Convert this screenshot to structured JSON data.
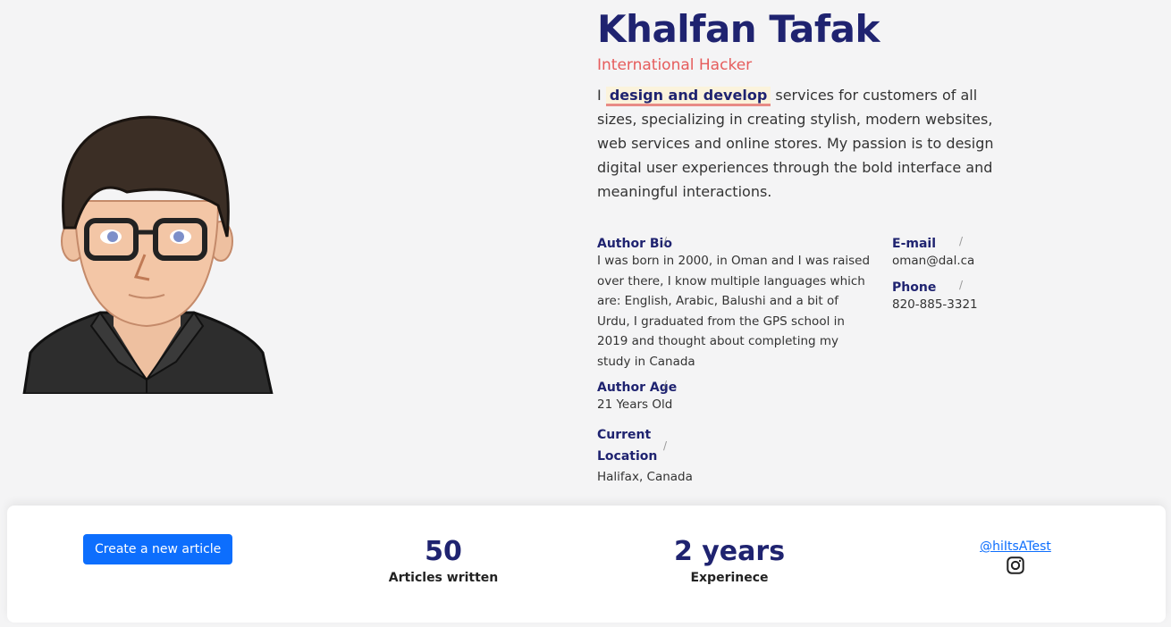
{
  "profile": {
    "name": "Khalfan Tafak",
    "role": "International Hacker",
    "intro_prefix": "I ",
    "intro_highlight": "design and develop",
    "intro_rest": " services for customers of all sizes, specializing in creating stylish, modern websites, web services and online stores. My passion is to design digital user experiences through the bold interface and meaningful interactions."
  },
  "details": {
    "bio_label": "Author Bio",
    "bio": "I was born in 2000, in Oman and I was raised over there, I know multiple languages which are: English, Arabic, Balushi and a bit of Urdu, I graduated from the GPS school in 2019 and thought about completing my study in Canada",
    "age_label": "Author Age",
    "age": "21 Years Old",
    "location_label": "Current Location",
    "location": "Halifax, Canada",
    "email_label": "E-mail",
    "email": "oman@dal.ca",
    "phone_label": "Phone",
    "phone": "820-885-3321",
    "separator": "/"
  },
  "stats": {
    "create_button": "Create a new article",
    "articles_value": "50",
    "articles_label": "Articles written",
    "experience_value": "2 years",
    "experience_label": "Experinece",
    "handle": "@hiItsATest"
  }
}
